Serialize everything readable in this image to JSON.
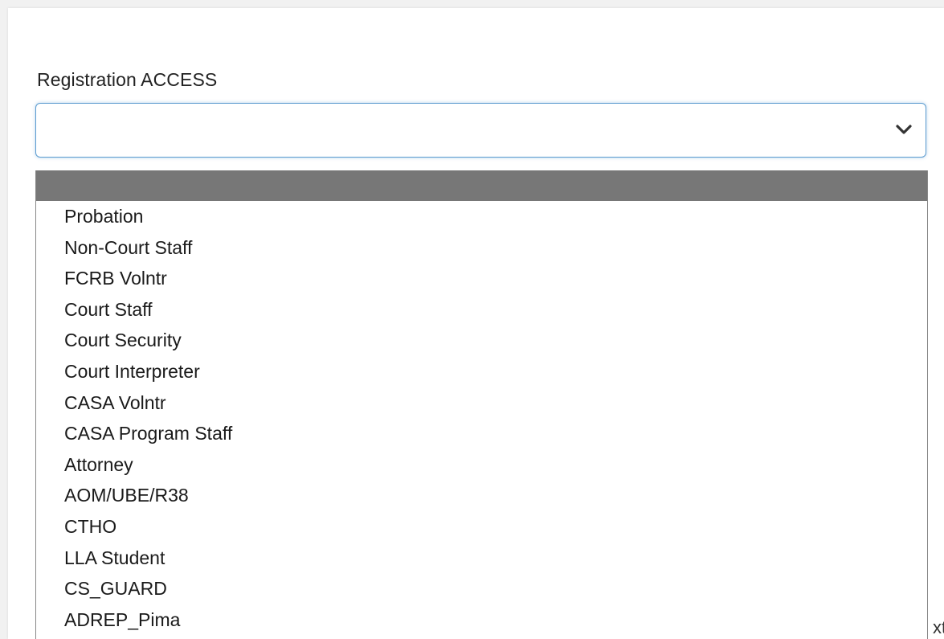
{
  "field": {
    "label": "Registration ACCESS",
    "selected_value": ""
  },
  "dropdown": {
    "highlighted_option": "",
    "options": [
      "Probation",
      "Non-Court Staff",
      "FCRB Volntr",
      "Court Staff",
      "Court Security",
      "Court Interpreter",
      "CASA Volntr",
      "CASA Program Staff",
      "Attorney",
      "AOM/UBE/R38",
      "CTHO",
      "LLA Student",
      "CS_GUARD",
      "ADREP_Pima"
    ]
  },
  "background": {
    "edge_fragment": "xt"
  },
  "icons": {
    "chevron": "chevron-down-icon"
  },
  "colors": {
    "focus_border": "#5c9ccf",
    "highlight": "#777777",
    "page_background": "#f1f1f1"
  }
}
